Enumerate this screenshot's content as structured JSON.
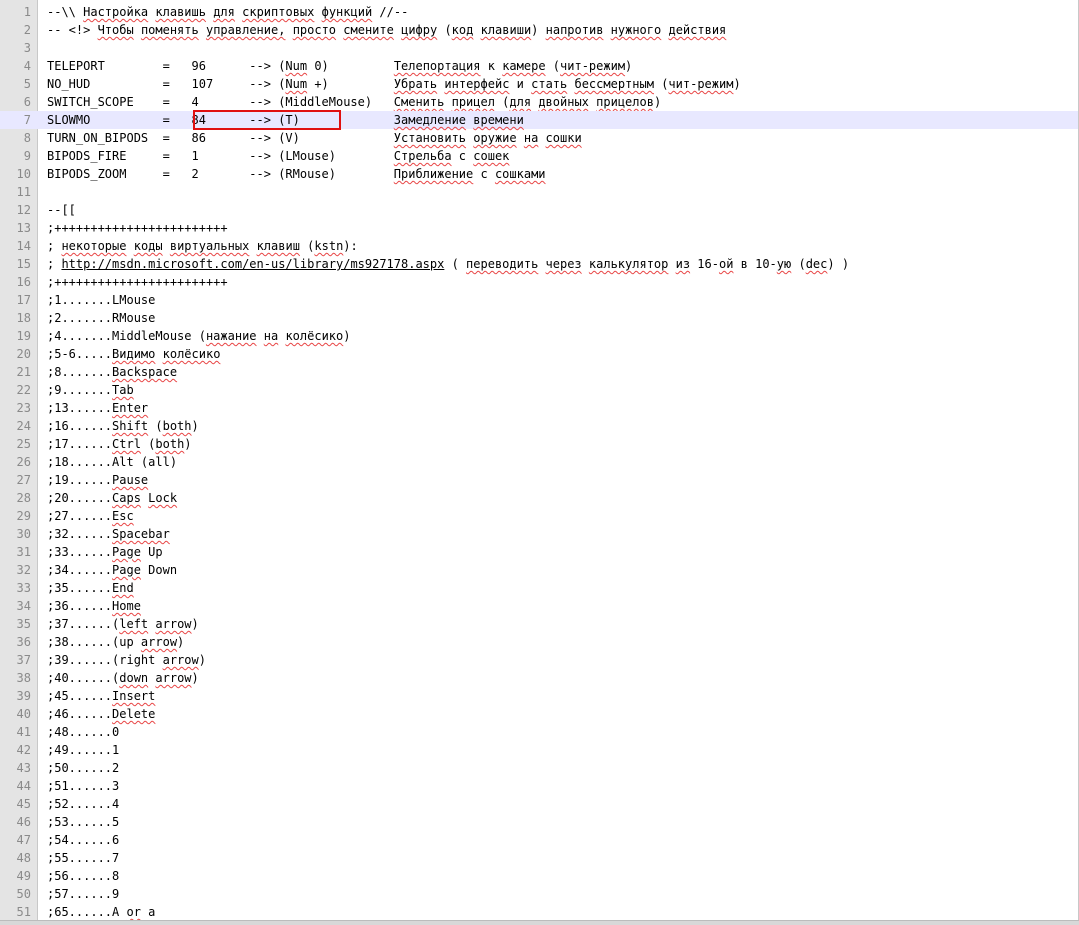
{
  "editor": {
    "highlight_color": "#e01010",
    "current_line_number": "7",
    "current_line_color": "#e8e8ff",
    "lines": [
      {
        "n": "1",
        "segments": [
          {
            "t": "--\\\\ "
          },
          {
            "t": "Настройка",
            "sq": true
          },
          {
            "t": " "
          },
          {
            "t": "клавишь",
            "sq": true
          },
          {
            "t": " "
          },
          {
            "t": "для",
            "sq": true
          },
          {
            "t": " "
          },
          {
            "t": "скриптовых",
            "sq": true
          },
          {
            "t": " "
          },
          {
            "t": "функций",
            "sq": true
          },
          {
            "t": " //--"
          }
        ]
      },
      {
        "n": "2",
        "segments": [
          {
            "t": "-- <!> "
          },
          {
            "t": "Чтобы",
            "sq": true
          },
          {
            "t": " "
          },
          {
            "t": "поменять",
            "sq": true
          },
          {
            "t": " "
          },
          {
            "t": "управление,",
            "sq": true
          },
          {
            "t": " "
          },
          {
            "t": "просто",
            "sq": true
          },
          {
            "t": " "
          },
          {
            "t": "смените",
            "sq": true
          },
          {
            "t": " "
          },
          {
            "t": "цифру",
            "sq": true
          },
          {
            "t": " ("
          },
          {
            "t": "код",
            "sq": true
          },
          {
            "t": " "
          },
          {
            "t": "клавиши",
            "sq": true
          },
          {
            "t": ") "
          },
          {
            "t": "напротив",
            "sq": true
          },
          {
            "t": " "
          },
          {
            "t": "нужного",
            "sq": true
          },
          {
            "t": " "
          },
          {
            "t": "действия",
            "sq": true
          }
        ]
      },
      {
        "n": "3",
        "segments": []
      },
      {
        "n": "4",
        "segments": [
          {
            "t": "TELEPORT        =   96      --> ("
          },
          {
            "t": "Num",
            "sq": true
          },
          {
            "t": " 0)         "
          },
          {
            "t": "Телепортация",
            "sq": true
          },
          {
            "t": " к "
          },
          {
            "t": "камере",
            "sq": true
          },
          {
            "t": " ("
          },
          {
            "t": "чит-режим",
            "sq": true
          },
          {
            "t": ")"
          }
        ]
      },
      {
        "n": "5",
        "segments": [
          {
            "t": "NO_HUD          =   107     --> ("
          },
          {
            "t": "Num",
            "sq": true
          },
          {
            "t": " +)         "
          },
          {
            "t": "Убрать",
            "sq": true
          },
          {
            "t": " "
          },
          {
            "t": "интерфейс",
            "sq": true
          },
          {
            "t": " и "
          },
          {
            "t": "стать",
            "sq": true
          },
          {
            "t": " "
          },
          {
            "t": "бессмертным",
            "sq": true
          },
          {
            "t": " ("
          },
          {
            "t": "чит-режим",
            "sq": true
          },
          {
            "t": ")"
          }
        ]
      },
      {
        "n": "6",
        "segments": [
          {
            "t": "SWITCH_SCOPE    =   4       --> (MiddleMouse)   "
          },
          {
            "t": "Сменить",
            "sq": true
          },
          {
            "t": " "
          },
          {
            "t": "прицел",
            "sq": true
          },
          {
            "t": " ("
          },
          {
            "t": "для",
            "sq": true
          },
          {
            "t": " "
          },
          {
            "t": "двойных",
            "sq": true
          },
          {
            "t": " "
          },
          {
            "t": "прицелов",
            "sq": true
          },
          {
            "t": ")"
          }
        ]
      },
      {
        "n": "7",
        "segments": [
          {
            "t": "SLOWMO          =   84      --> (T)             "
          },
          {
            "t": "Замедление",
            "sq": true
          },
          {
            "t": " "
          },
          {
            "t": "времени",
            "sq": true
          }
        ]
      },
      {
        "n": "8",
        "segments": [
          {
            "t": "TURN_ON_BIPODS  =   86      --> (V)             "
          },
          {
            "t": "Установить",
            "sq": true
          },
          {
            "t": " "
          },
          {
            "t": "оружие",
            "sq": true
          },
          {
            "t": " "
          },
          {
            "t": "на",
            "sq": true
          },
          {
            "t": " "
          },
          {
            "t": "сошки",
            "sq": true
          }
        ]
      },
      {
        "n": "9",
        "segments": [
          {
            "t": "BIPODS_FIRE     =   1       --> (LMouse)        "
          },
          {
            "t": "Стрельба",
            "sq": true
          },
          {
            "t": " с "
          },
          {
            "t": "сошек",
            "sq": true
          }
        ]
      },
      {
        "n": "10",
        "segments": [
          {
            "t": "BIPODS_ZOOM     =   2       --> (RMouse)        "
          },
          {
            "t": "Приближение",
            "sq": true
          },
          {
            "t": " с "
          },
          {
            "t": "сошками",
            "sq": true
          }
        ]
      },
      {
        "n": "11",
        "segments": []
      },
      {
        "n": "12",
        "segments": [
          {
            "t": "--[["
          }
        ]
      },
      {
        "n": "13",
        "segments": [
          {
            "t": ";++++++++++++++++++++++++"
          }
        ]
      },
      {
        "n": "14",
        "segments": [
          {
            "t": "; "
          },
          {
            "t": "некоторые",
            "sq": true
          },
          {
            "t": " "
          },
          {
            "t": "коды",
            "sq": true
          },
          {
            "t": " "
          },
          {
            "t": "виртуальных",
            "sq": true
          },
          {
            "t": " "
          },
          {
            "t": "клавиш",
            "sq": true
          },
          {
            "t": " ("
          },
          {
            "t": "kstn",
            "sq": true
          },
          {
            "t": "):"
          }
        ]
      },
      {
        "n": "15",
        "segments": [
          {
            "t": "; "
          },
          {
            "t": "http://msdn.microsoft.com/en-us/library/ms927178.aspx",
            "url": true
          },
          {
            "t": " ( "
          },
          {
            "t": "переводить",
            "sq": true
          },
          {
            "t": " "
          },
          {
            "t": "через",
            "sq": true
          },
          {
            "t": " "
          },
          {
            "t": "калькулятор",
            "sq": true
          },
          {
            "t": " "
          },
          {
            "t": "из",
            "sq": true
          },
          {
            "t": " 16-"
          },
          {
            "t": "ой",
            "sq": true
          },
          {
            "t": " в 10-"
          },
          {
            "t": "ую",
            "sq": true
          },
          {
            "t": " ("
          },
          {
            "t": "dec",
            "sq": true
          },
          {
            "t": ") )"
          }
        ]
      },
      {
        "n": "16",
        "segments": [
          {
            "t": ";++++++++++++++++++++++++"
          }
        ]
      },
      {
        "n": "17",
        "segments": [
          {
            "t": ";1.......LMouse"
          }
        ]
      },
      {
        "n": "18",
        "segments": [
          {
            "t": ";2.......RMouse"
          }
        ]
      },
      {
        "n": "19",
        "segments": [
          {
            "t": ";4.......MiddleMouse ("
          },
          {
            "t": "нажание",
            "sq": true
          },
          {
            "t": " "
          },
          {
            "t": "на",
            "sq": true
          },
          {
            "t": " "
          },
          {
            "t": "колёсико",
            "sq": true
          },
          {
            "t": ")"
          }
        ]
      },
      {
        "n": "20",
        "segments": [
          {
            "t": ";5-6....."
          },
          {
            "t": "Видимо",
            "sq": true
          },
          {
            "t": " "
          },
          {
            "t": "колёсико",
            "sq": true
          }
        ]
      },
      {
        "n": "21",
        "segments": [
          {
            "t": ";8......."
          },
          {
            "t": "Backspace",
            "sq": true
          }
        ]
      },
      {
        "n": "22",
        "segments": [
          {
            "t": ";9......."
          },
          {
            "t": "Tab",
            "sq": true
          }
        ]
      },
      {
        "n": "23",
        "segments": [
          {
            "t": ";13......"
          },
          {
            "t": "Enter",
            "sq": true
          }
        ]
      },
      {
        "n": "24",
        "segments": [
          {
            "t": ";16......"
          },
          {
            "t": "Shift",
            "sq": true
          },
          {
            "t": " ("
          },
          {
            "t": "both",
            "sq": true
          },
          {
            "t": ")"
          }
        ]
      },
      {
        "n": "25",
        "segments": [
          {
            "t": ";17......"
          },
          {
            "t": "Ctrl",
            "sq": true
          },
          {
            "t": " ("
          },
          {
            "t": "both",
            "sq": true
          },
          {
            "t": ")"
          }
        ]
      },
      {
        "n": "26",
        "segments": [
          {
            "t": ";18......Alt (all)"
          }
        ]
      },
      {
        "n": "27",
        "segments": [
          {
            "t": ";19......"
          },
          {
            "t": "Pause",
            "sq": true
          }
        ]
      },
      {
        "n": "28",
        "segments": [
          {
            "t": ";20......"
          },
          {
            "t": "Caps",
            "sq": true
          },
          {
            "t": " "
          },
          {
            "t": "Lock",
            "sq": true
          }
        ]
      },
      {
        "n": "29",
        "segments": [
          {
            "t": ";27......"
          },
          {
            "t": "Esc",
            "sq": true
          }
        ]
      },
      {
        "n": "30",
        "segments": [
          {
            "t": ";32......"
          },
          {
            "t": "Spacebar",
            "sq": true
          }
        ]
      },
      {
        "n": "31",
        "segments": [
          {
            "t": ";33......"
          },
          {
            "t": "Page",
            "sq": true
          },
          {
            "t": " Up"
          }
        ]
      },
      {
        "n": "32",
        "segments": [
          {
            "t": ";34......"
          },
          {
            "t": "Page",
            "sq": true
          },
          {
            "t": " Down"
          }
        ]
      },
      {
        "n": "33",
        "segments": [
          {
            "t": ";35......"
          },
          {
            "t": "End",
            "sq": true
          }
        ]
      },
      {
        "n": "34",
        "segments": [
          {
            "t": ";36......"
          },
          {
            "t": "Home",
            "sq": true
          }
        ]
      },
      {
        "n": "35",
        "segments": [
          {
            "t": ";37......("
          },
          {
            "t": "left",
            "sq": true
          },
          {
            "t": " "
          },
          {
            "t": "arrow",
            "sq": true
          },
          {
            "t": ")"
          }
        ]
      },
      {
        "n": "36",
        "segments": [
          {
            "t": ";38......(up "
          },
          {
            "t": "arrow",
            "sq": true
          },
          {
            "t": ")"
          }
        ]
      },
      {
        "n": "37",
        "segments": [
          {
            "t": ";39......(right "
          },
          {
            "t": "arrow",
            "sq": true
          },
          {
            "t": ")"
          }
        ]
      },
      {
        "n": "38",
        "segments": [
          {
            "t": ";40......("
          },
          {
            "t": "down",
            "sq": true
          },
          {
            "t": " "
          },
          {
            "t": "arrow",
            "sq": true
          },
          {
            "t": ")"
          }
        ]
      },
      {
        "n": "39",
        "segments": [
          {
            "t": ";45......"
          },
          {
            "t": "Insert",
            "sq": true
          }
        ]
      },
      {
        "n": "40",
        "segments": [
          {
            "t": ";46......"
          },
          {
            "t": "Delete",
            "sq": true
          }
        ]
      },
      {
        "n": "41",
        "segments": [
          {
            "t": ";48......0"
          }
        ]
      },
      {
        "n": "42",
        "segments": [
          {
            "t": ";49......1"
          }
        ]
      },
      {
        "n": "43",
        "segments": [
          {
            "t": ";50......2"
          }
        ]
      },
      {
        "n": "44",
        "segments": [
          {
            "t": ";51......3"
          }
        ]
      },
      {
        "n": "45",
        "segments": [
          {
            "t": ";52......4"
          }
        ]
      },
      {
        "n": "46",
        "segments": [
          {
            "t": ";53......5"
          }
        ]
      },
      {
        "n": "47",
        "segments": [
          {
            "t": ";54......6"
          }
        ]
      },
      {
        "n": "48",
        "segments": [
          {
            "t": ";55......7"
          }
        ]
      },
      {
        "n": "49",
        "segments": [
          {
            "t": ";56......8"
          }
        ]
      },
      {
        "n": "50",
        "segments": [
          {
            "t": ";57......9"
          }
        ]
      },
      {
        "n": "51",
        "segments": [
          {
            "t": ";65......A "
          },
          {
            "t": "or",
            "sq": true
          },
          {
            "t": " a"
          }
        ]
      }
    ]
  }
}
